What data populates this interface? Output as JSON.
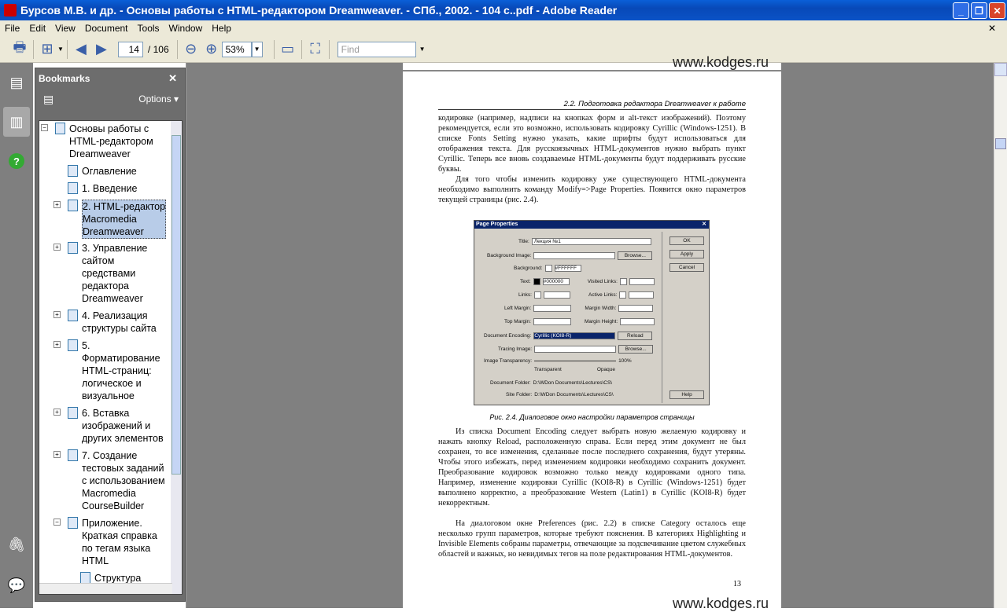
{
  "window": {
    "title": "Бурсов М.В. и др. - Основы работы с HTML-редактором Dreamweaver. - СПб., 2002. - 104 с..pdf - Adobe Reader"
  },
  "menu": [
    "File",
    "Edit",
    "View",
    "Document",
    "Tools",
    "Window",
    "Help"
  ],
  "toolbar": {
    "page_current": "14",
    "page_total": "/ 106",
    "zoom": "53%",
    "find_placeholder": "Find"
  },
  "bookmarks": {
    "title": "Bookmarks",
    "options": "Options",
    "items": [
      {
        "label": "Основы работы с HTML-редактором Dreamweaver",
        "lines": [
          "Основы работы с",
          "HTML-редактором",
          "Dreamweaver"
        ]
      },
      {
        "lines": [
          "Оглавление"
        ]
      },
      {
        "lines": [
          "1. Введение"
        ]
      },
      {
        "lines": [
          "2. HTML-редактор",
          "Macromedia",
          "Dreamweaver"
        ]
      },
      {
        "lines": [
          "3. Управление",
          "сайтом",
          "средствами",
          "редактора",
          "Dreamweaver"
        ]
      },
      {
        "lines": [
          "4. Реализация",
          "структуры сайта"
        ]
      },
      {
        "lines": [
          "5.",
          "Форматирование",
          "HTML-страниц:",
          "логическое и",
          "визуальное"
        ]
      },
      {
        "lines": [
          "6. Вставка",
          "изображений и",
          "других элементов"
        ]
      },
      {
        "lines": [
          "7. Создание",
          "тестовых заданий",
          "с использованием",
          "Macromedia",
          "CourseBuilder"
        ]
      },
      {
        "lines": [
          "Приложение.",
          "Краткая справка",
          "по тегам языка",
          "HTML"
        ]
      },
      {
        "lines": [
          "Структура"
        ]
      }
    ]
  },
  "page": {
    "watermark": "www.kodges.ru",
    "running_head": "2.2. Подготовка редактора Dreamweaver к работе",
    "para1": "кодировке (например, надписи на кнопках форм и alt-текст изображений). Поэтому рекомендуется, если это возможно, использовать кодировку Cyrillic (Windows-1251). В списке Fonts Setting нужно указать, какие шрифты будут использоваться для отображения текста. Для русскоязычных HTML-документов нужно выбрать пункт Cyrillic. Теперь все вновь создаваемые HTML-документы будут поддерживать русские буквы.",
    "para2": "Для того чтобы изменить кодировку уже существующего HTML-документа необходимо выполнить команду Modify=>Page Properties. Появится окно параметров текущей страницы (рис. 2.4).",
    "caption": "Рис. 2.4. Диалоговое окно настройки параметров страницы",
    "para3": "Из списка Document Encoding следует выбрать новую желаемую кодировку и нажать кнопку Reload, расположенную справа. Если перед этим документ не был сохранен, то все изменения, сделанные после последнего сохранения, будут утеряны. Чтобы этого избежать, перед изменением кодировки необходимо сохранить документ. Преобразование кодировок возможно только между кодировками одного типа. Например, изменение кодировки Cyrillic (KOI8-R) в Cyrillic (Windows-1251) будет выполнено корректно, а преобразование Western (Latin1) в Cyrillic (KOI8-R) будет некорректным.",
    "para4": "На диалоговом окне Preferences (рис. 2.2) в списке Category осталось еще несколько групп параметров, которые требуют пояснения. В категориях Highlighting и Invisible Elements собраны параметры, отвечающие за подсвечивание цветом служебных областей и важных, но невидимых тегов на поле редактирования HTML-документов.",
    "page_number": "13"
  },
  "dialog": {
    "title": "Page Properties",
    "title_value": "Лекция №1",
    "bg_color": "#FFFFFF",
    "text_color": "#000000",
    "encoding": "Cyrillic (KOI8-R)",
    "doc_folder": "D:\\WDon Documents\\Lectures\\CS\\",
    "site_folder": "D:\\WDon Documents\\Lectures\\CS\\",
    "labels": {
      "title": "Title:",
      "bgimg": "Background Image:",
      "bg": "Background:",
      "text": "Text:",
      "links": "Links:",
      "vlinks": "Visited Links:",
      "alinks": "Active Links:",
      "lm": "Left Margin:",
      "mw": "Margin Width:",
      "tm": "Top Margin:",
      "mh": "Margin Height:",
      "enc": "Document Encoding:",
      "trace": "Tracing Image:",
      "transp": "Image Transparency:",
      "transparent": "Transparent",
      "opaque": "Opaque",
      "pct": "100%",
      "docf": "Document Folder:",
      "sitef": "Site Folder:"
    },
    "buttons": {
      "ok": "OK",
      "apply": "Apply",
      "cancel": "Cancel",
      "help": "Help",
      "browse": "Browse...",
      "reload": "Reload"
    }
  }
}
